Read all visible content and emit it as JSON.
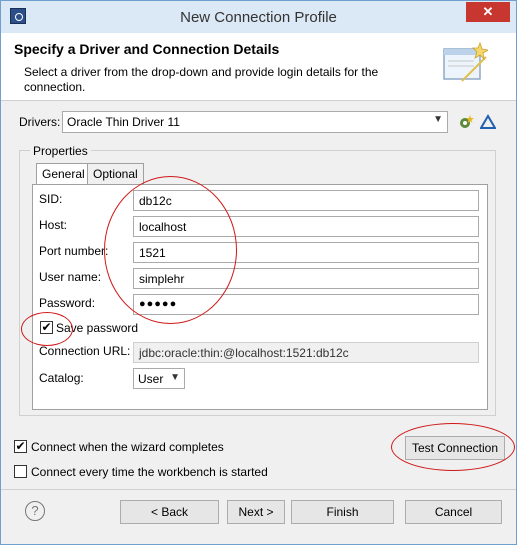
{
  "window": {
    "title": "New Connection Profile",
    "close_glyph": "✕"
  },
  "banner": {
    "title": "Specify a Driver and Connection Details",
    "description": "Select a driver from the drop-down and provide login details for the connection."
  },
  "drivers": {
    "label": "Drivers:",
    "selected": "Oracle Thin Driver 11"
  },
  "properties": {
    "group_label": "Properties",
    "tabs": [
      "General",
      "Optional"
    ],
    "fields": {
      "sid": {
        "label": "SID:",
        "value": "db12c"
      },
      "host": {
        "label": "Host:",
        "value": "localhost"
      },
      "port": {
        "label": "Port number:",
        "value": "1521"
      },
      "user": {
        "label": "User name:",
        "value": "simplehr"
      },
      "password": {
        "label": "Password:",
        "value": "●●●●●"
      },
      "save_password": {
        "label": "Save password",
        "checked": true
      },
      "url": {
        "label": "Connection URL:",
        "value": "jdbc:oracle:thin:@localhost:1521:db12c"
      },
      "catalog": {
        "label": "Catalog:",
        "value": "User"
      }
    }
  },
  "options": {
    "connect_on_finish": {
      "label": "Connect when the wizard completes",
      "checked": true
    },
    "connect_every_time": {
      "label": "Connect every time the workbench is started",
      "checked": false
    }
  },
  "buttons": {
    "test": "Test Connection",
    "back": "< Back",
    "next": "Next >",
    "finish": "Finish",
    "cancel": "Cancel"
  },
  "icons": {
    "app": "eclipse-icon",
    "wizard": "wizard-banner-icon",
    "new_driver": "new-driver-icon",
    "edit_driver": "edit-driver-icon",
    "help": "help-icon"
  },
  "colors": {
    "annotation": "#d01818",
    "titlebar": "#dbe8f5",
    "close": "#c7372f"
  }
}
